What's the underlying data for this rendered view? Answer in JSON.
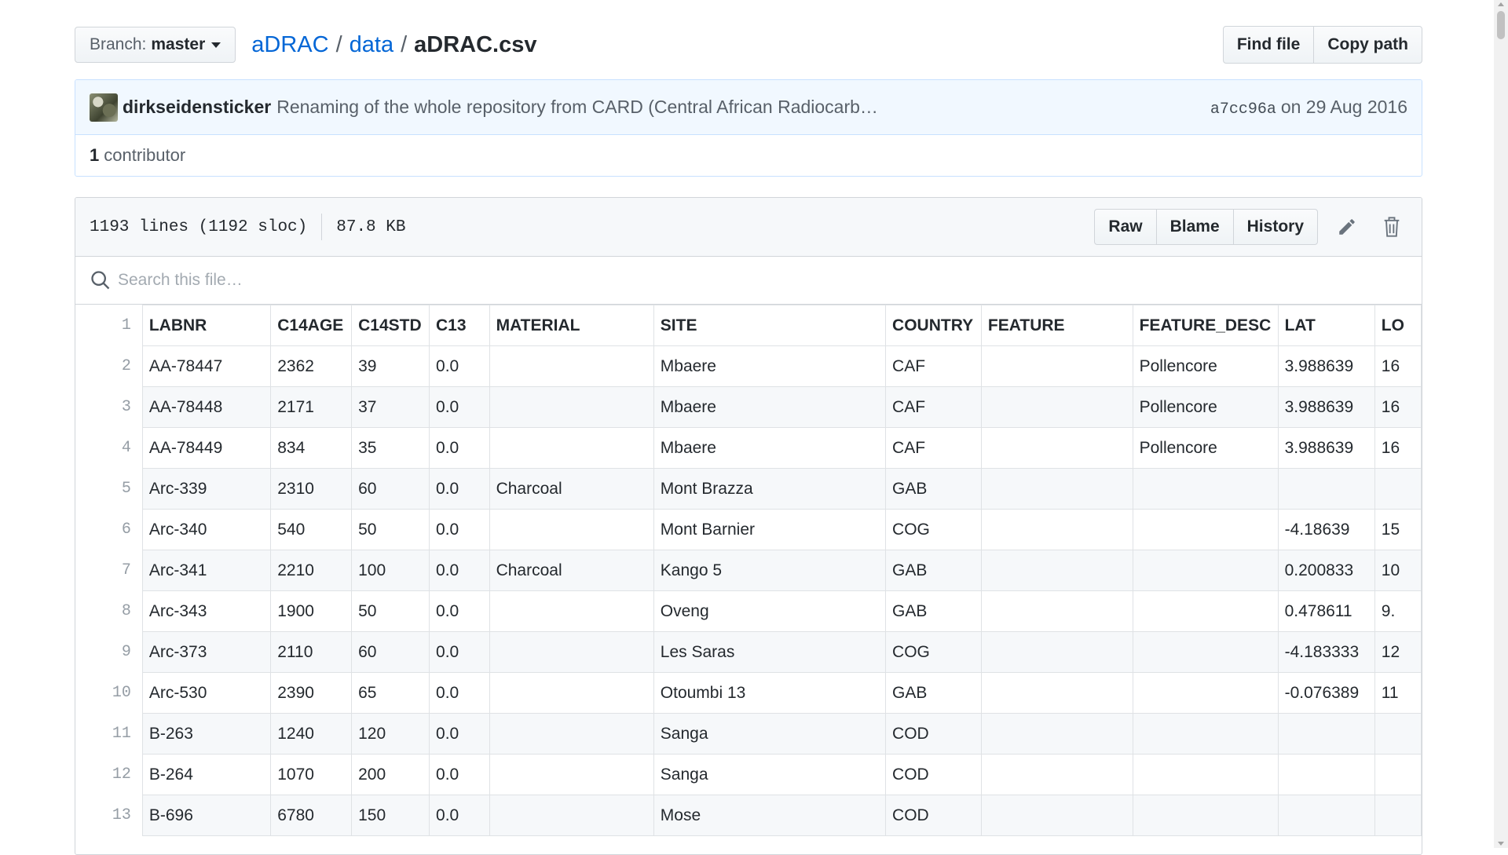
{
  "branch": {
    "prefix": "Branch:",
    "name": "master"
  },
  "breadcrumb": {
    "root": "aDRAC",
    "sep": "/",
    "folder": "data",
    "file": "aDRAC.csv"
  },
  "top_buttons": {
    "find_file": "Find file",
    "copy_path": "Copy path"
  },
  "commit": {
    "author": "dirkseidensticker",
    "message": "Renaming of the whole repository from CARD (Central African Radiocarb…",
    "sha": "a7cc96a",
    "date": "on 29 Aug 2016"
  },
  "contributors": {
    "count": "1",
    "label": "contributor"
  },
  "file": {
    "lines": "1193 lines (1192 sloc)",
    "size": "87.8 KB",
    "raw_label": "Raw",
    "blame_label": "Blame",
    "history_label": "History",
    "edit_icon": "pencil-icon",
    "delete_icon": "trash-icon"
  },
  "search": {
    "placeholder": "Search this file…"
  },
  "table": {
    "header_line": "1",
    "columns": [
      "LABNR",
      "C14AGE",
      "C14STD",
      "C13",
      "MATERIAL",
      "SITE",
      "COUNTRY",
      "FEATURE",
      "FEATURE_DESC",
      "LAT",
      "LO"
    ],
    "rows": [
      {
        "line": "2",
        "cells": [
          "AA-78447",
          "2362",
          "39",
          "0.0",
          "",
          "Mbaere",
          "CAF",
          "",
          "Pollencore",
          "3.988639",
          "16"
        ]
      },
      {
        "line": "3",
        "cells": [
          "AA-78448",
          "2171",
          "37",
          "0.0",
          "",
          "Mbaere",
          "CAF",
          "",
          "Pollencore",
          "3.988639",
          "16"
        ]
      },
      {
        "line": "4",
        "cells": [
          "AA-78449",
          "834",
          "35",
          "0.0",
          "",
          "Mbaere",
          "CAF",
          "",
          "Pollencore",
          "3.988639",
          "16"
        ]
      },
      {
        "line": "5",
        "cells": [
          "Arc-339",
          "2310",
          "60",
          "0.0",
          "Charcoal",
          "Mont Brazza",
          "GAB",
          "",
          "",
          "",
          ""
        ]
      },
      {
        "line": "6",
        "cells": [
          "Arc-340",
          "540",
          "50",
          "0.0",
          "",
          "Mont Barnier",
          "COG",
          "",
          "",
          "-4.18639",
          "15"
        ]
      },
      {
        "line": "7",
        "cells": [
          "Arc-341",
          "2210",
          "100",
          "0.0",
          "Charcoal",
          "Kango 5",
          "GAB",
          "",
          "",
          "0.200833",
          "10"
        ]
      },
      {
        "line": "8",
        "cells": [
          "Arc-343",
          "1900",
          "50",
          "0.0",
          "",
          "Oveng",
          "GAB",
          "",
          "",
          "0.478611",
          "9."
        ]
      },
      {
        "line": "9",
        "cells": [
          "Arc-373",
          "2110",
          "60",
          "0.0",
          "",
          "Les Saras",
          "COG",
          "",
          "",
          "-4.183333",
          "12"
        ]
      },
      {
        "line": "10",
        "cells": [
          "Arc-530",
          "2390",
          "65",
          "0.0",
          "",
          "Otoumbi 13",
          "GAB",
          "",
          "",
          "-0.076389",
          "11"
        ]
      },
      {
        "line": "11",
        "cells": [
          "B-263",
          "1240",
          "120",
          "0.0",
          "",
          "Sanga",
          "COD",
          "",
          "",
          "",
          ""
        ]
      },
      {
        "line": "12",
        "cells": [
          "B-264",
          "1070",
          "200",
          "0.0",
          "",
          "Sanga",
          "COD",
          "",
          "",
          "",
          ""
        ]
      },
      {
        "line": "13",
        "cells": [
          "B-696",
          "6780",
          "150",
          "0.0",
          "",
          "Mose",
          "COD",
          "",
          "",
          "",
          ""
        ]
      }
    ]
  },
  "colors": {
    "link": "#0366d6",
    "commit_bg": "#f1f8ff",
    "commit_border": "#c8e1ff",
    "header_bg": "#f6f8fa",
    "border": "#d1d5da"
  }
}
